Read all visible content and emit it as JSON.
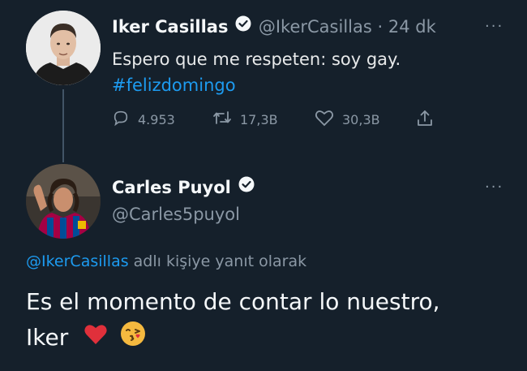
{
  "tweet1": {
    "name": "Iker Casillas",
    "handle": "@IkerCasillas",
    "dot": "·",
    "time": "24 dk",
    "text_line1": "Espero que me respeten: soy gay.",
    "hashtag": "#felizdomingo",
    "replies": "4.953",
    "retweets": "17,3B",
    "likes": "30,3B",
    "more": "···"
  },
  "tweet2": {
    "name": "Carles Puyol",
    "handle": "@Carles5puyol",
    "more": "···",
    "reply_to_handle": "@IkerCasillas",
    "reply_to_text": " adlı kişiye yanıt olarak",
    "text_line1": "Es el momento de contar lo nuestro,",
    "text_line2": "Iker",
    "emoji_heart": "❤️",
    "emoji_kiss": "😘"
  },
  "colors": {
    "background": "#15202b",
    "accent": "#1d9bf0",
    "muted": "#8b98a5",
    "thread_line": "#425466"
  },
  "icons": [
    "reply-icon",
    "retweet-icon",
    "like-icon",
    "share-icon",
    "verified-icon",
    "more-icon"
  ]
}
